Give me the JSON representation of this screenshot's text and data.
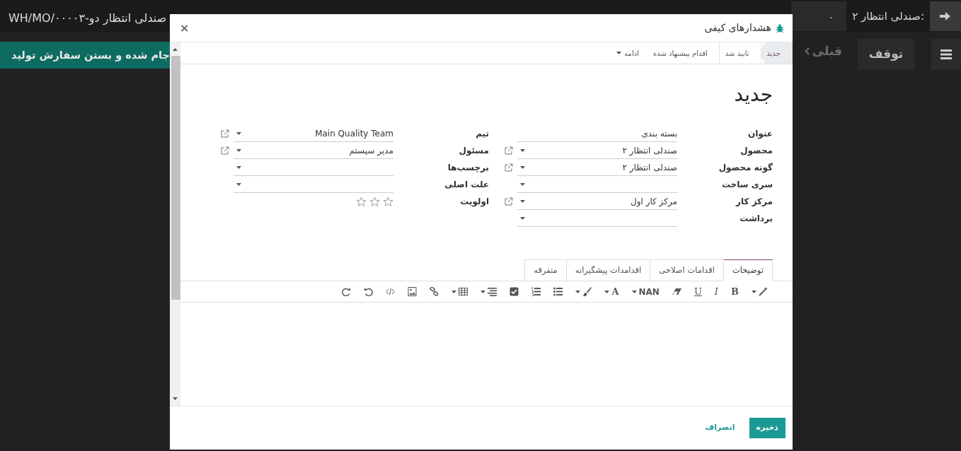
{
  "background": {
    "breadcrumb": "WH/MO/۰۰۰۰۳-صندلی انتظار دو",
    "quantity_label": "صندلی انتظار ۲:",
    "quantity_value": "۰",
    "stop_button": "توقف",
    "previous_button": "قبلی",
    "banner": "جام شده و بستن سفارش تولید"
  },
  "dialog": {
    "close_button": "×",
    "title": "هشدارهای کیفی",
    "stages": [
      {
        "label": "جدید",
        "selected": true
      },
      {
        "label": "تایید شد",
        "selected": false
      },
      {
        "label": "اقدام پیشنهاد شده",
        "selected": false
      }
    ],
    "more_stages": "ادامه",
    "record_title": "جدید",
    "fields_right": [
      {
        "kind": "char",
        "label": "عنوان",
        "value": "بسته بندی",
        "link": false
      },
      {
        "kind": "many2one",
        "label": "محصول",
        "value": "صندلی انتظار ۲",
        "link": true
      },
      {
        "kind": "many2one",
        "label": "گونه محصول",
        "value": "صندلی انتظار ۲",
        "link": true
      },
      {
        "kind": "many2one",
        "label": "سری ساخت",
        "link": false
      },
      {
        "kind": "many2one",
        "label": "مرکز کار",
        "value": "مرکز کار اول",
        "link": true
      },
      {
        "kind": "many2one",
        "label": "برداشت",
        "link": false
      }
    ],
    "fields_left": [
      {
        "kind": "many2one",
        "label": "تیم",
        "value": "Main Quality Team",
        "link": true
      },
      {
        "kind": "many2one",
        "label": "مسئول",
        "value": "مدیر سیستم",
        "link": true
      },
      {
        "kind": "many2one",
        "label": "برچسب‌ها",
        "link": false
      },
      {
        "kind": "many2one",
        "label": "علت اصلی",
        "link": false
      },
      {
        "kind": "priority",
        "label": "اولویت",
        "stars": 0
      }
    ],
    "tabs": [
      {
        "label": "توضیحات",
        "selected": true
      },
      {
        "label": "اقدامات اصلاحی",
        "selected": false
      },
      {
        "label": "اقدامدات پیشگیرانه",
        "selected": false
      },
      {
        "label": "متفرقه",
        "selected": false
      }
    ],
    "toolbar": [
      {
        "kind": "wand",
        "dropdown": true
      },
      {
        "kind": "bold",
        "label": "B"
      },
      {
        "kind": "italic",
        "label": "I"
      },
      {
        "kind": "underline",
        "label": "U"
      },
      {
        "kind": "eraser"
      },
      {
        "kind": "font-size",
        "label": "NAN",
        "dropdown": true
      },
      {
        "kind": "font-color",
        "label": "A",
        "dropdown": true
      },
      {
        "kind": "brush",
        "dropdown": true
      },
      {
        "kind": "bullets"
      },
      {
        "kind": "numbers"
      },
      {
        "kind": "check"
      },
      {
        "kind": "align",
        "dropdown": true
      },
      {
        "kind": "table",
        "dropdown": true
      },
      {
        "kind": "link"
      },
      {
        "kind": "image"
      },
      {
        "kind": "code"
      },
      {
        "kind": "undo"
      },
      {
        "kind": "redo"
      }
    ],
    "save_button": "ذخیره",
    "cancel_button": "انصراف"
  }
}
